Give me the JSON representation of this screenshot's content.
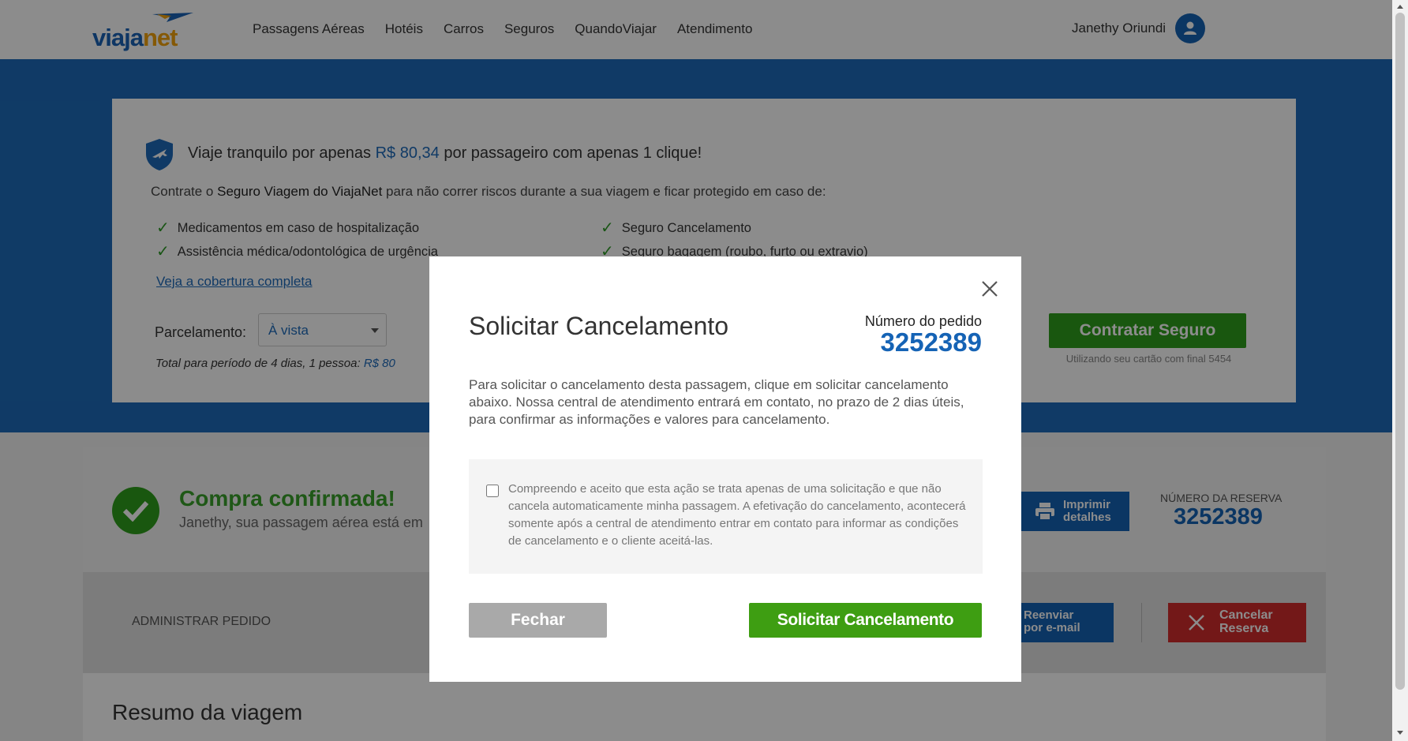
{
  "header": {
    "logo": {
      "part1": "viaja",
      "part2": "net"
    },
    "nav": [
      "Passagens Aéreas",
      "Hotéis",
      "Carros",
      "Seguros",
      "QuandoViajar",
      "Atendimento"
    ],
    "user_name": "Janethy Oriundi"
  },
  "insurance": {
    "title_pre": "Viaje tranquilo por apenas",
    "title_price": "R$ 80,34",
    "title_post": "por passageiro com apenas 1 clique!",
    "sub_pre": "Contrate o",
    "sub_bold": "Seguro Viagem do ViajaNet",
    "sub_post": "para não correr riscos durante a sua viagem e ficar protegido em caso de:",
    "coverages": [
      "Medicamentos em caso de hospitalização",
      "Assistência médica/odontológica de urgência",
      "Seguro Cancelamento",
      "Seguro bagagem (roubo, furto ou extravio)"
    ],
    "link": "Veja a cobertura completa",
    "parcelamento_label": "Parcelamento:",
    "parcelamento_value": "À vista",
    "total_text": "Total para período de 4 dias, 1 pessoa:",
    "total_value": "R$ 80",
    "button": "Contratar Seguro",
    "card_note": "Utilizando seu cartão com final 5454"
  },
  "confirmation": {
    "title": "Compra confirmada!",
    "subtitle": "Janethy, sua passagem aérea está em",
    "print_line1": "Imprimir",
    "print_line2": "detalhes",
    "reserva_label": "NÚMERO DA RESERVA",
    "reserva_number": "3252389"
  },
  "admin": {
    "label": "ADMINISTRAR PEDIDO",
    "resend_line1": "Reenviar",
    "resend_line2": "por e-mail",
    "cancel_line1": "Cancelar",
    "cancel_line2": "Reserva"
  },
  "summary": {
    "title": "Resumo da viagem"
  },
  "modal": {
    "title": "Solicitar Cancelamento",
    "order_label": "Número do pedido",
    "order_number": "3252389",
    "body": "Para solicitar o cancelamento desta passagem, clique em solicitar cancelamento abaixo. Nossa central de atendimento entrará em contato, no prazo de 2 dias úteis, para confirmar as informações e valores para cancelamento.",
    "checkbox_text": "Compreendo e aceito que esta ação se trata apenas de uma solicitação e que não cancela automaticamente minha passagem. A efetivação do cancelamento, acontecerá somente após a central de atendimento entrar em contato para informar as condições de cancelamento e o cliente aceitá-las.",
    "checkbox_checked": false,
    "close_button": "Fechar",
    "submit_button": "Solicitar Cancelamento"
  },
  "colors": {
    "brand_blue": "#1e6bba",
    "brand_orange": "#f2a20c",
    "success_green": "#3e9e12",
    "danger_red": "#d22c2c"
  }
}
